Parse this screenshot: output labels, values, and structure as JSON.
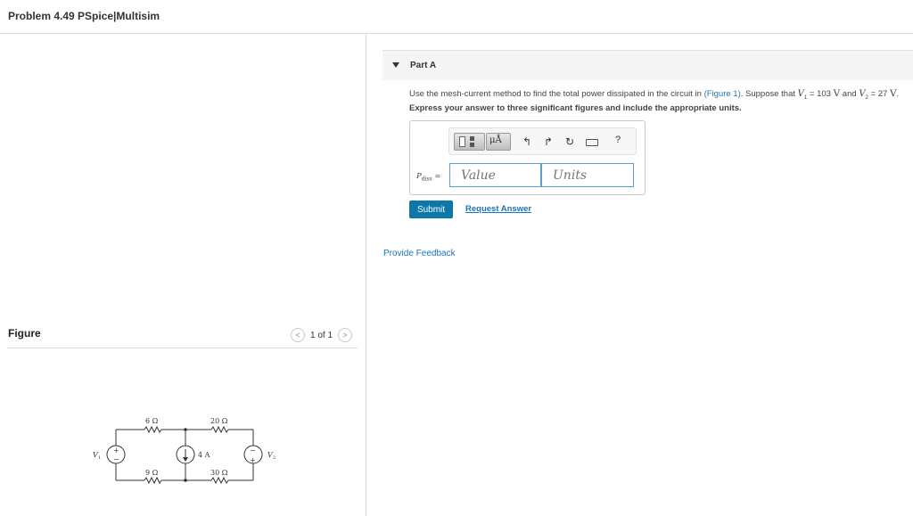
{
  "header": {
    "title": "Problem 4.49 PSpice|Multisim"
  },
  "figure_panel": {
    "label": "Figure",
    "pager": {
      "current": "1 of 1",
      "prev_icon": "chevron-left-icon",
      "next_icon": "chevron-right-icon"
    },
    "circuit": {
      "resistors": [
        "6 Ω",
        "20 Ω",
        "9 Ω",
        "30 Ω"
      ],
      "current_source": "4 A",
      "sources": [
        "V₁",
        "V₂"
      ],
      "plus": "+",
      "minus": "−",
      "sub1": "1",
      "sub2": "2"
    }
  },
  "part_a": {
    "title": "Part A",
    "question": {
      "prefix": "Use the mesh-current method to find the total power dissipated in the circuit in ",
      "link": "(Figure 1)",
      "mid1": ". Suppose that ",
      "v1_sym": "V",
      "v1_sub": "1",
      "v1_eq": " = 103 ",
      "v1_unit": "V",
      "and": " and ",
      "v2_sym": "V",
      "v2_sub": "2",
      "v2_eq": " = 27 ",
      "v2_unit": "V",
      "end": "."
    },
    "instruction": "Express your answer to three significant figures and include the appropriate units.",
    "toolbar": {
      "units_btn": "μÅ",
      "undo_icon": "undo-icon",
      "redo_icon": "redo-icon",
      "reset_icon": "reset-icon",
      "keyboard_icon": "keyboard-icon",
      "help": "?"
    },
    "variable": {
      "symbol": "P",
      "subscript": "diss",
      "eq": " ="
    },
    "value_placeholder": "Value",
    "units_placeholder": "Units",
    "submit_label": "Submit",
    "request_answer_label": "Request Answer"
  },
  "feedback_label": "Provide Feedback"
}
